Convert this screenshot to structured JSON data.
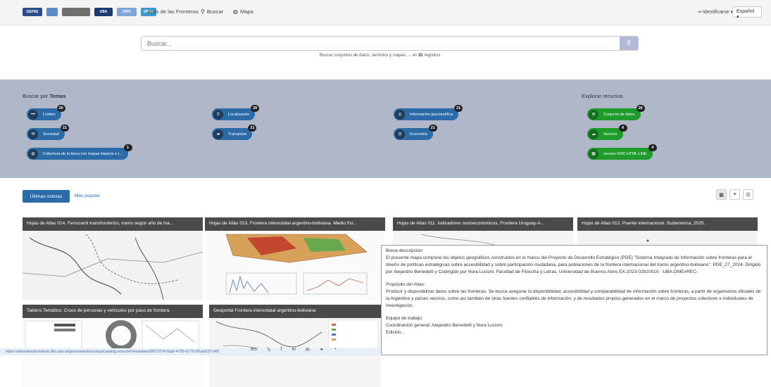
{
  "header": {
    "logos": [
      "GEFRE",
      "UBA",
      "UNTI",
      "OPDA"
    ],
    "site_title": "Atlas de las Fronteras",
    "search_link": "Buscar",
    "map_link": "Mapa",
    "login": "Identificarse",
    "language": "Español"
  },
  "search": {
    "placeholder": "Buscar...",
    "hint_prefix": "Buscar conjuntos de datos, servicios y mapas, ... en",
    "hint_count": "31",
    "hint_suffix": "registros"
  },
  "themes": {
    "title_prefix": "Buscar por",
    "title_bold": "Temas",
    "items": [
      {
        "label": "Límites",
        "count": "26",
        "icon": "dots-icon"
      },
      {
        "label": "Localización",
        "count": "26",
        "icon": "pin-icon"
      },
      {
        "label": "Información geocientífica",
        "count": "21",
        "icon": "target-icon"
      },
      {
        "label": "Sociedad",
        "count": "21",
        "icon": "chat-icon"
      },
      {
        "label": "Transporte",
        "count": "21",
        "icon": "truck-icon"
      },
      {
        "label": "Economía",
        "count": "21",
        "icon": "cart-icon"
      },
      {
        "label": "Cobertura de la tierra con mapas básicos e i...",
        "count": "1",
        "icon": "globe-icon"
      }
    ],
    "explore_title": "Explorar recursos",
    "resources": [
      {
        "label": "Conjunto de datos",
        "count": "26",
        "icon": "database-icon"
      },
      {
        "label": "Servicio",
        "count": "4",
        "icon": "cloud-icon"
      },
      {
        "label": "service-W3C:HTML:LINK",
        "count": "4",
        "icon": "table-icon"
      }
    ]
  },
  "tabs": {
    "active": "Últimas noticias",
    "other": "Más popular"
  },
  "cards": [
    {
      "title": "Hojas de Atlas 014. Ferrocarril transfronterizo, tramo según año de ina..."
    },
    {
      "title": "Hojas de Atlas 013. Frontera interestatal argentino-boliviana. Medio físi..."
    },
    {
      "title": "Hojas de Atlas 011. Indicadores socioeconómicos. Frontera Uruguay-A..."
    },
    {
      "title": "Hojas de Atlas 012. Puente internacional. Sudamérica, 2025."
    },
    {
      "title": "Tablero Temático: Cruce de personas y vehículos por paso de frontera."
    },
    {
      "title": "Geoportal Frontera interestatal argentino-boliviana"
    }
  ],
  "popover": {
    "desc_label": "Breve descripción:",
    "desc_text": "El presente mapa compone los objetos geográficos construidos en el marco del Proyecto de Desarrollo Estratégico (PDE) \"Sistema Integrado de Información sobre fronteras para el diseño de políticas estratégicas sobre accesibilidad y sobre participación ciudadana, para poblaciones de la frontera internacional del tramo argentino-boliviano\". PDE_27_2024. Dirigido por Alejandro Benedetti y Codirigido por Nora Lucioni. Facultad de Filosofía y Letras, Universidad de Buenos Aires EX-2023-02810510- -UBA-DME#REC-.",
    "purpose_label": "Propósito del Atlas:",
    "purpose_text": "Producir y disponibilizar datos sobre las fronteras. Se busca asegurar la disponibilidad, accesibilidad y comparabilidad de información sobre fronteras, a partir de organismos oficiales de la Argentina y países vecinos, como así también de otras fuentes confiables de información, y de resultados propios generados en el marco de proyectos colectivos e individuales de investigación.",
    "team_label": "Equipo de trabajo:",
    "team_text": "Coordinación general: Alejandro Benedetti y Nora Lucioni.",
    "edition": "Edición..."
  },
  "statusbar": "https://atlasdelasfronteras.filo.uba.ar/geonetwork/srv/spa/catalog.search#/metadata/0f873724-5daf-4705-b779-3f1ab627c4f9",
  "footer": {
    "partial_text": "ies",
    "social": [
      "twitter-icon",
      "facebook-icon",
      "linkedin-icon",
      "email-icon",
      "link-icon",
      "rss-icon"
    ]
  }
}
